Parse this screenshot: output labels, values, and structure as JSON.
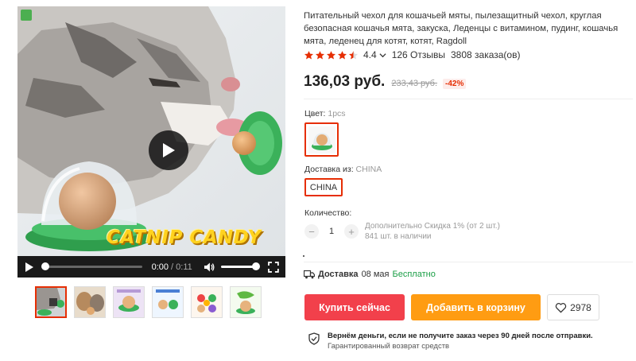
{
  "product": {
    "title": "Питательный чехол для кошачьей мяты, пылезащитный чехол, круглая безопасная кошачья мята, закуска, Леденцы с витамином, пудинг, кошачья мята, леденец для котят, котят, Ragdoll",
    "rating": "4.4",
    "rating_stars": 4.5,
    "reviews": "126 Отзывы",
    "orders": "3808 заказа(ов)"
  },
  "price": {
    "current": "136,03 руб.",
    "old": "233,43 руб.",
    "discount": "-42%"
  },
  "media": {
    "banner_text": "CATNIP CANDY",
    "time_current": "0:00",
    "time_separator": " / ",
    "time_total": "0:11",
    "progress": 0.0,
    "volume": 1.0,
    "thumbnail_count": 6
  },
  "color": {
    "label": "Цвет: ",
    "value": "1pcs"
  },
  "shipping": {
    "label": "Доставка из: ",
    "value": "CHINA",
    "option": "CHINA"
  },
  "quantity": {
    "label": "Количество:",
    "value": "1",
    "minus": "−",
    "plus": "+",
    "discount_note": "Дополнительно Скидка 1% (от 2 шт.)",
    "stock": "841 шт. в наличии"
  },
  "delivery": {
    "label": "Доставка",
    "date": "08 мая",
    "cost": "Бесплатно"
  },
  "actions": {
    "buy": "Купить сейчас",
    "cart": "Добавить в корзину",
    "wishlist_count": "2978"
  },
  "guarantee": {
    "title": "Вернём деньги, если не получите заказ через 90 дней после отправки.",
    "subtitle": "Гарантированный возврат средств"
  },
  "colors": {
    "accent": "#e62e04",
    "buy": "#f2404b",
    "cart": "#ff9c12",
    "free": "#1a9e46",
    "star": "#e62e04"
  }
}
